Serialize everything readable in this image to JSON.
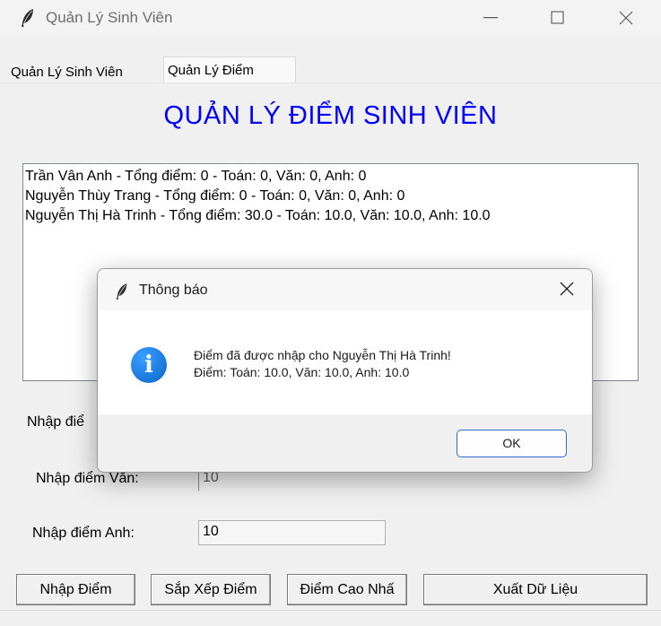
{
  "window": {
    "title": "Quản Lý Sinh Viên",
    "minimize_symbol": "—",
    "close_symbol": "✕",
    "icon": "feather-icon"
  },
  "tabs": [
    {
      "label": "Quản Lý Sinh Viên",
      "selected": false
    },
    {
      "label": "Quản Lý Điểm",
      "selected": true
    }
  ],
  "main": {
    "heading": "QUẢN LÝ ĐIỂM SINH VIÊN",
    "heading_color": "#0000ff",
    "list_items": [
      "Trần Vân Anh - Tổng điểm: 0 - Toán: 0, Văn: 0, Anh: 0",
      "Nguyễn Thùy Trang - Tổng điểm: 0 - Toán: 0, Văn: 0, Anh: 0",
      "Nguyễn Thị Hà Trinh - Tổng điểm: 30.0 - Toán: 10.0, Văn: 10.0, Anh: 10.0"
    ]
  },
  "form": {
    "toan_label_partial": "Nhập điể",
    "van_label": "Nhập điểm Văn:",
    "van_value": "10",
    "anh_label": "Nhập điểm Anh:",
    "anh_value": "10"
  },
  "buttons": {
    "nhap_diem": "Nhập Điểm",
    "sap_xep": "Sắp Xếp Điểm",
    "diem_cao_nhat": "Điểm Cao Nhấ",
    "xuat_du_lieu": "Xuất Dữ Liệu"
  },
  "dialog": {
    "title": "Thông báo",
    "icon": "info-icon",
    "info_glyph": "i",
    "message_line1": "Điểm đã được nhập cho Nguyễn Thị Hà Trinh!",
    "message_line2": "Điểm: Toán: 10.0, Văn: 10.0, Anh: 10.0",
    "ok_label": "OK",
    "close_symbol": "✕",
    "accent_color": "#2f6bd1"
  }
}
